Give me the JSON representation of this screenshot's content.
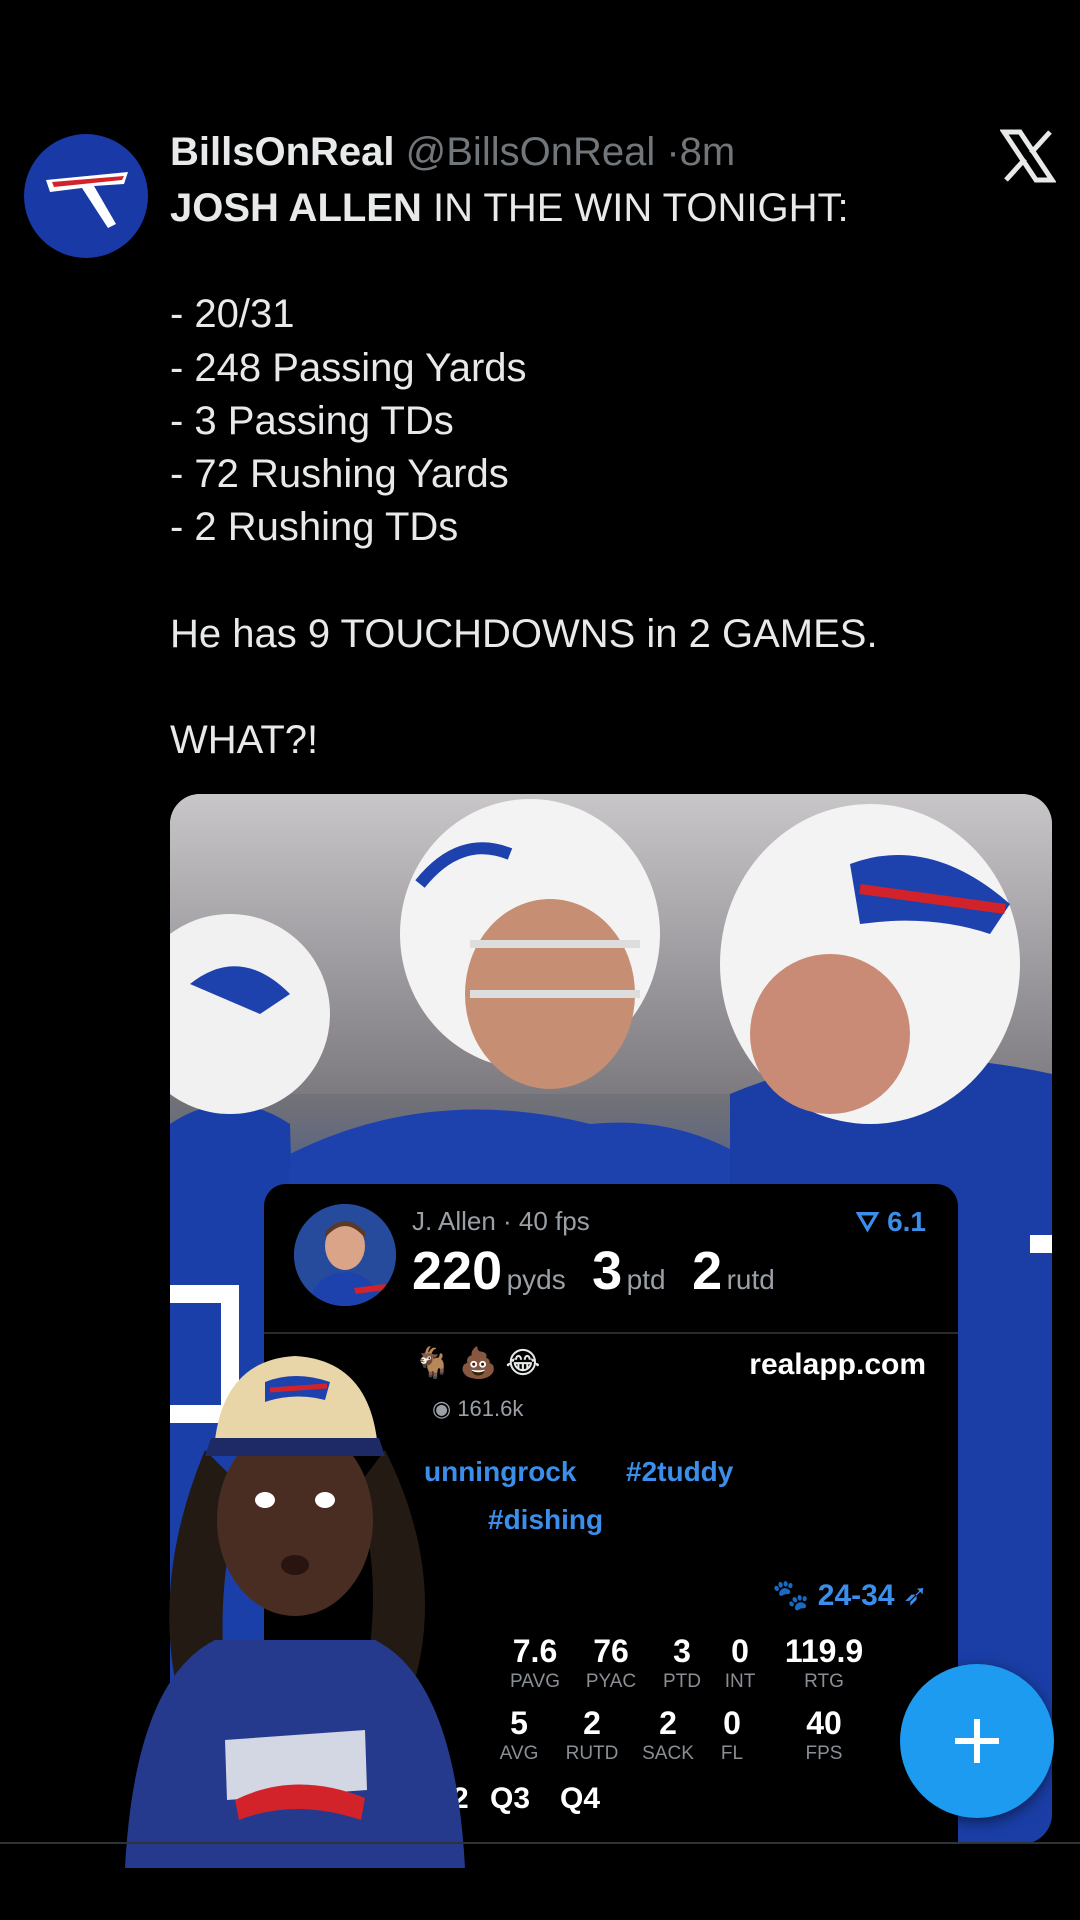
{
  "tweet": {
    "author_name": "BillsOnReal",
    "author_handle": "@BillsOnReal",
    "separator": "·",
    "time_ago": "8m",
    "text_headline_bold": "JOSH ALLEN",
    "text_headline_rest": " IN THE WIN TONIGHT:",
    "stats": [
      "- 20/31",
      "- 248 Passing Yards",
      "- 3 Passing TDs",
      "- 72 Rushing Yards",
      "- 2 Rushing TDs"
    ],
    "line_touchdowns": "He has 9 TOUCHDOWNS in 2 GAMES.",
    "line_exclaim": "WHAT?!"
  },
  "stat_card": {
    "player_line": "J. Allen · 40 fps",
    "rating": "6.1",
    "pyds_value": "220",
    "pyds_unit": "pyds",
    "ptd_value": "3",
    "ptd_unit": "ptd",
    "rutd_value": "2",
    "rutd_unit": "rutd",
    "reactions": "🐐 💩 😂",
    "site": "realapp.com",
    "views": "161.6k",
    "hashtags": [
      "unningrock",
      "#2tuddy",
      "#dishing"
    ],
    "score": "24-34",
    "row1": [
      {
        "value": "7.6",
        "label": "PAVG"
      },
      {
        "value": "76",
        "label": "PYAC"
      },
      {
        "value": "3",
        "label": "PTD"
      },
      {
        "value": "0",
        "label": "INT"
      },
      {
        "value": "119.9",
        "label": "RTG"
      }
    ],
    "row2": [
      {
        "value": "5",
        "label": "AVG"
      },
      {
        "value": "2",
        "label": "RUTD"
      },
      {
        "value": "2",
        "label": "SACK"
      },
      {
        "value": "0",
        "label": "FL"
      },
      {
        "value": "40",
        "label": "FPS"
      }
    ],
    "quarters": [
      "2",
      "Q3",
      "Q4"
    ]
  },
  "icons": {
    "x_logo": "x-logo-icon",
    "fab": "plus-icon",
    "views": "eye-icon",
    "avatar": "bills-logo-icon"
  },
  "colors": {
    "background": "#000000",
    "text_primary": "#e7e9ea",
    "text_secondary": "#71767b",
    "accent_blue": "#1d9bf0",
    "bills_blue": "#1839a6",
    "bills_red": "#d2232a"
  }
}
